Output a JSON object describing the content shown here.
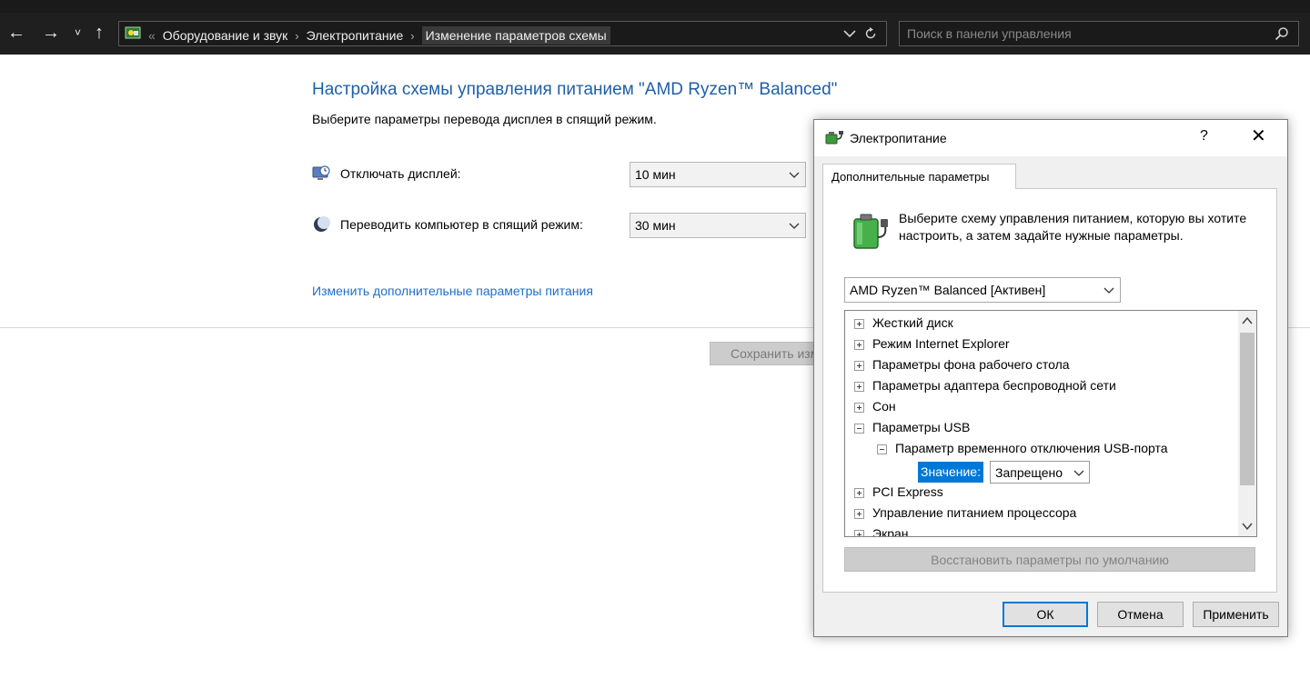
{
  "nav": {
    "back": "←",
    "forward": "→",
    "recent": "˅",
    "up": "↑"
  },
  "address": {
    "prefix": "«",
    "crumbs": [
      "Оборудование и звук",
      "Электропитание",
      "Изменение параметров схемы"
    ],
    "separator": "›"
  },
  "search": {
    "placeholder": "Поиск в панели управления"
  },
  "page": {
    "title": "Настройка схемы управления питанием \"AMD Ryzen™ Balanced\"",
    "subtitle": "Выберите параметры перевода дисплея в спящий режим.",
    "display_off_label": "Отключать дисплей:",
    "display_off_value": "10 мин",
    "sleep_label": "Переводить компьютер в спящий режим:",
    "sleep_value": "30 мин",
    "advanced_link": "Изменить дополнительные параметры питания",
    "save_button": "Сохранить изменения"
  },
  "dialog": {
    "title": "Электропитание",
    "help": "?",
    "close": "✕",
    "tab": "Дополнительные параметры",
    "intro": "Выберите схему управления питанием, которую вы хотите настроить, а затем задайте нужные параметры.",
    "scheme": "AMD Ryzen™ Balanced [Активен]",
    "tree": [
      {
        "label": "Жесткий диск",
        "state": "collapsed",
        "level": 0
      },
      {
        "label": "Режим Internet Explorer",
        "state": "collapsed",
        "level": 0
      },
      {
        "label": "Параметры фона рабочего стола",
        "state": "collapsed",
        "level": 0
      },
      {
        "label": "Параметры адаптера беспроводной сети",
        "state": "collapsed",
        "level": 0
      },
      {
        "label": "Сон",
        "state": "collapsed",
        "level": 0
      },
      {
        "label": "Параметры USB",
        "state": "expanded",
        "level": 0
      },
      {
        "label": "Параметр временного отключения USB-порта",
        "state": "expanded",
        "level": 1
      },
      {
        "label": "PCI Express",
        "state": "collapsed",
        "level": 0
      },
      {
        "label": "Управление питанием процессора",
        "state": "collapsed",
        "level": 0
      },
      {
        "label": "Экран",
        "state": "collapsed",
        "level": 0
      }
    ],
    "value_label": "Значение:",
    "value": "Запрещено",
    "restore_button": "Восстановить параметры по умолчанию",
    "ok": "ОК",
    "cancel": "Отмена",
    "apply": "Применить"
  },
  "colors": {
    "accent": "#0078d7",
    "link": "#1e6fc9",
    "title": "#1e5fa8",
    "topbar": "#1f1f1f"
  },
  "icons": [
    "control-panel-icon",
    "refresh-icon",
    "search-icon",
    "monitor-clock-icon",
    "moon-icon",
    "power-options-icon",
    "battery-plug-icon"
  ]
}
